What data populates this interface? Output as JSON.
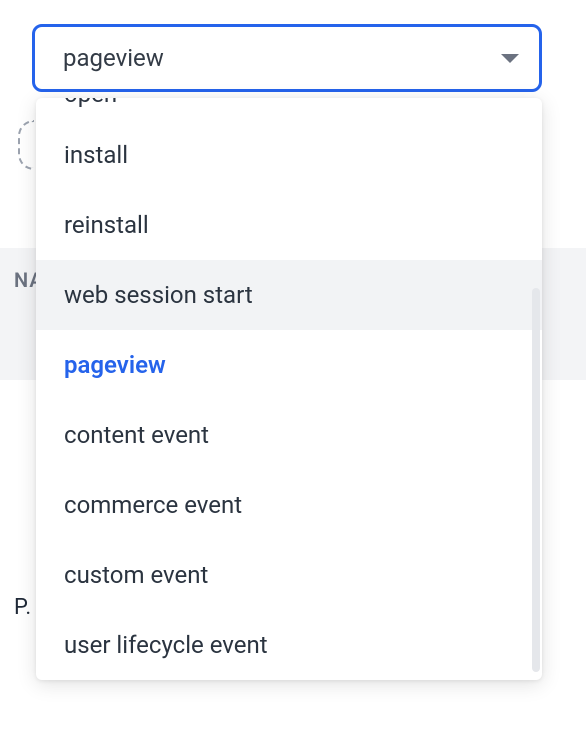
{
  "select": {
    "value": "pageview"
  },
  "bg": {
    "label_na": "NA",
    "label_p": "P."
  },
  "dropdown": {
    "options": [
      {
        "label": "open",
        "truncated": true
      },
      {
        "label": "install"
      },
      {
        "label": "reinstall"
      },
      {
        "label": "web session start",
        "hovered": true
      },
      {
        "label": "pageview",
        "selected": true
      },
      {
        "label": "content event"
      },
      {
        "label": "commerce event"
      },
      {
        "label": "custom event"
      },
      {
        "label": "user lifecycle event"
      }
    ]
  }
}
